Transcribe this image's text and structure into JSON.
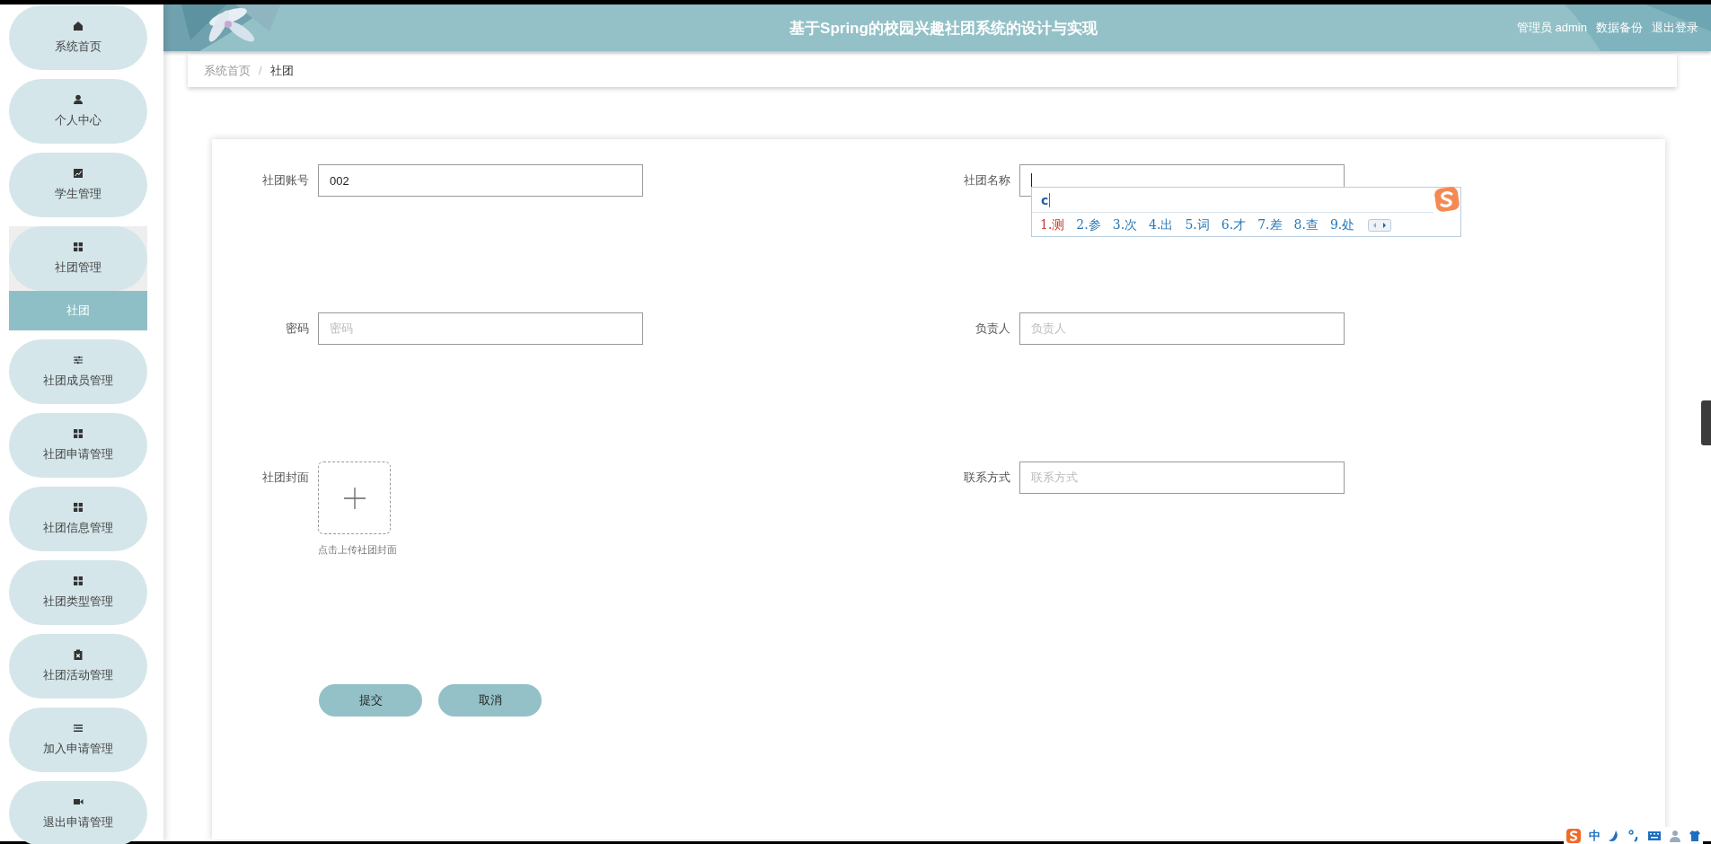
{
  "header": {
    "title": "基于Spring的校园兴趣社团系统的设计与实现",
    "links": [
      "管理员 admin",
      "数据备份",
      "退出登录"
    ]
  },
  "sidebar": {
    "items": [
      {
        "label": "系统首页",
        "selected": false
      },
      {
        "label": "个人中心",
        "selected": false
      },
      {
        "label": "学生管理",
        "selected": false
      },
      {
        "label": "社团管理",
        "selected": false,
        "expanded": true,
        "children": [
          {
            "label": "社团",
            "selected": true
          }
        ]
      },
      {
        "label": "社团成员管理",
        "selected": false
      },
      {
        "label": "社团申请管理",
        "selected": false
      },
      {
        "label": "社团信息管理",
        "selected": false
      },
      {
        "label": "社团类型管理",
        "selected": false
      },
      {
        "label": "社团活动管理",
        "selected": false
      },
      {
        "label": "加入申请管理",
        "selected": false
      },
      {
        "label": "退出申请管理",
        "selected": false
      }
    ]
  },
  "breadcrumb": {
    "items": [
      "系统首页",
      "社团"
    ],
    "separator": "/"
  },
  "form": {
    "fields": [
      {
        "kind": "text",
        "label": "社团账号",
        "value": "002",
        "focused": false
      },
      {
        "kind": "text",
        "label": "社团名称",
        "focused": true
      },
      {
        "kind": "text",
        "label": "密码",
        "placeholder": "密码",
        "focused": false
      },
      {
        "kind": "text",
        "label": "负责人",
        "placeholder": "负责人",
        "focused": false
      },
      {
        "kind": "upload",
        "label": "社团封面",
        "hint": "点击上传社团封面"
      },
      {
        "kind": "text",
        "label": "联系方式",
        "placeholder": "联系方式",
        "focused": false
      }
    ],
    "buttons": [
      "提交",
      "取消"
    ]
  },
  "ime": {
    "composition": "c",
    "candidates": [
      {
        "label": "1.测",
        "selected": true
      },
      {
        "label": "2.参",
        "selected": false
      },
      {
        "label": "3.次",
        "selected": false
      },
      {
        "label": "4.出",
        "selected": false
      },
      {
        "label": "5.词",
        "selected": false
      },
      {
        "label": "6.才",
        "selected": false
      },
      {
        "label": "7.差",
        "selected": false
      },
      {
        "label": "8.查",
        "selected": false
      },
      {
        "label": "9.处",
        "selected": false
      }
    ]
  },
  "ime_status": {
    "mode": "中"
  }
}
